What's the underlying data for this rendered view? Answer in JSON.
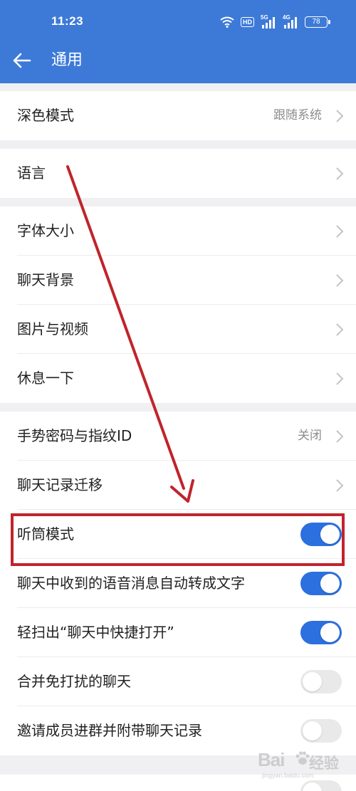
{
  "status_bar": {
    "time": "11:23",
    "hd": "HD",
    "network_1": "5G",
    "network_2": "4G",
    "battery": "78"
  },
  "header": {
    "title": "通用",
    "back_icon": "arrow-left-icon",
    "background": "#3d7ad8"
  },
  "settings": {
    "dark_mode": {
      "label": "深色模式",
      "value": "跟随系统"
    },
    "language": {
      "label": "语言"
    },
    "font_size": {
      "label": "字体大小"
    },
    "chat_background": {
      "label": "聊天背景"
    },
    "photos_videos": {
      "label": "图片与视频"
    },
    "take_a_break": {
      "label": "休息一下"
    },
    "gesture_password": {
      "label": "手势密码与指纹ID",
      "value": "关闭"
    },
    "chat_migration": {
      "label": "聊天记录迁移"
    },
    "earpiece_mode": {
      "label": "听筒模式",
      "enabled": true
    },
    "voice_to_text": {
      "label": "聊天中收到的语音消息自动转成文字",
      "enabled": true
    },
    "quick_open": {
      "label": "轻扫出“聊天中快捷打开”",
      "enabled": true
    },
    "merge_muted": {
      "label": "合并免打扰的聊天",
      "enabled": false
    },
    "invite_history": {
      "label": "邀请成员进群并附带聊天记录",
      "enabled": false
    }
  },
  "colors": {
    "toggle_on": "#2c6fde",
    "toggle_off": "#e9e9e9",
    "annotation_red": "#c0242c"
  },
  "watermark": {
    "logo": "Bai",
    "cn": "经验",
    "url": "jingyan.baidu.com"
  }
}
